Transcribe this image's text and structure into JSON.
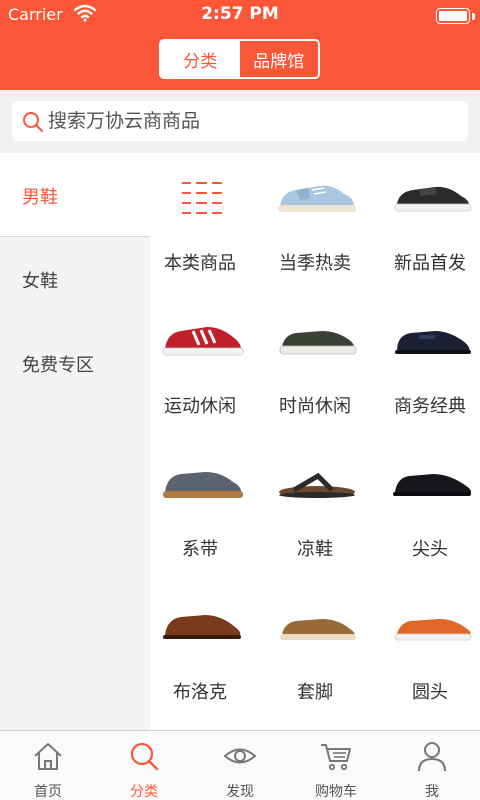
{
  "status_bar": {
    "carrier": "Carrier",
    "time": "2:57 PM"
  },
  "segment": {
    "tabs": [
      {
        "label": "分类"
      },
      {
        "label": "品牌馆"
      }
    ]
  },
  "search": {
    "placeholder": "搜索万协云商商品"
  },
  "sidebar": {
    "items": [
      {
        "label": "男鞋"
      },
      {
        "label": "女鞋"
      },
      {
        "label": "免费专区"
      }
    ]
  },
  "grid": {
    "items": [
      {
        "label": "本类商品",
        "icon": "list-icon"
      },
      {
        "label": "当季热卖",
        "icon": "canvas-sneaker-image"
      },
      {
        "label": "新品首发",
        "icon": "leather-sneaker-image"
      },
      {
        "label": "运动休闲",
        "icon": "sport-shoe-image"
      },
      {
        "label": "时尚休闲",
        "icon": "slip-on-shoe-image"
      },
      {
        "label": "商务经典",
        "icon": "monk-strap-shoe-image"
      },
      {
        "label": "系带",
        "icon": "suede-lace-up-image"
      },
      {
        "label": "凉鞋",
        "icon": "flip-flop-image"
      },
      {
        "label": "尖头",
        "icon": "pointed-shoe-image"
      },
      {
        "label": "布洛克",
        "icon": "brogue-shoe-image"
      },
      {
        "label": "套脚",
        "icon": "loafer-shoe-image"
      },
      {
        "label": "圆头",
        "icon": "round-toe-shoe-image"
      }
    ]
  },
  "tabbar": {
    "items": [
      {
        "label": "首页",
        "icon": "home-icon"
      },
      {
        "label": "分类",
        "icon": "search-icon"
      },
      {
        "label": "发现",
        "icon": "eye-icon"
      },
      {
        "label": "购物车",
        "icon": "cart-icon"
      },
      {
        "label": "我",
        "icon": "user-icon"
      }
    ]
  },
  "colors": {
    "accent": "#fb5637"
  }
}
